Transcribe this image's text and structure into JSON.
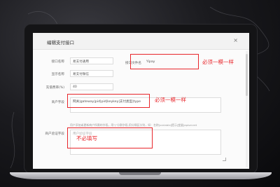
{
  "modal": {
    "title": "编辑支付接口",
    "close_glyph": "×"
  },
  "form": {
    "interface_name": {
      "label": "接口名称",
      "value": "易支付通用"
    },
    "display_name": {
      "label": "显示名称",
      "value": "易支付微信"
    },
    "fee_rate": {
      "label": "充值费率(%)",
      "value": "40"
    },
    "file_name": {
      "label": "接口文件名",
      "value": "Yipay"
    },
    "merchant_field": {
      "label": "商户字段",
      "value": "网关|gateway|pid|pid|keykey|支付类型|type"
    },
    "merchant_hint": "用户添加或更新商户所需的字段，用\"|\"分割字段,用分隔区分别，如：名称|variable|提示|变量|apisecret",
    "verify_field": {
      "label": "商户验证字段",
      "placeholder": "用户验证字段"
    }
  },
  "annotations": {
    "must_match_1": "必须一模一样",
    "must_match_2": "必须一模一样",
    "not_required": "不必填写"
  },
  "colors": {
    "annotation_red": "#e8262b",
    "header_bg": "#f2f2f2"
  }
}
